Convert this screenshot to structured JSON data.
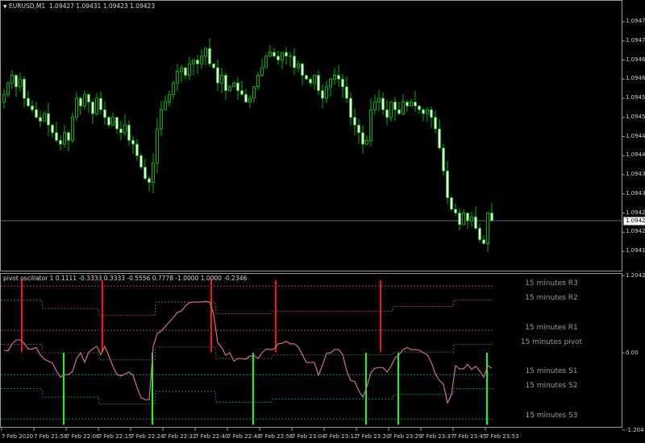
{
  "main_header": {
    "arrow_icon": "triangle-down-icon",
    "symbol": "EURUSD,M1",
    "ohlc": "1.09427 1.09431 1.09423 1.09423"
  },
  "osc_header": {
    "text": "pivot oscillator 1 0.1111 -0.3333 0.3333 -0.5556 0.7778 -1.0000 1.0000 -0.2346"
  },
  "price_axis": {
    "ticks": [
      "1.09475",
      "1.09470",
      "1.09465",
      "1.09460",
      "1.09455",
      "1.09450",
      "1.09445",
      "1.09440",
      "1.09435",
      "1.09430",
      "1.09425",
      "1.09420",
      "1.09415"
    ],
    "current": "1.09423"
  },
  "osc_axis": {
    "ticks": [
      "1.2042",
      "0.00",
      "-1.204"
    ]
  },
  "time_axis": {
    "labels": [
      "7 Feb 2020",
      "7 Feb 21:58",
      "7 Feb 22:06",
      "7 Feb 22:15",
      "7 Feb 22:24",
      "7 Feb 22:32",
      "7 Feb 22:40",
      "7 Feb 22:48",
      "7 Feb 22:56",
      "7 Feb 23:04",
      "7 Feb 23:12",
      "7 Feb 23:20",
      "7 Feb 23:29",
      "7 Feb 23:37",
      "7 Feb 23:45",
      "7 Feb 23:53"
    ]
  },
  "level_labels": {
    "r3": "15 minutes R3",
    "r2": "15 minutes R2",
    "r1": "15 minutes R1",
    "pivot": "15 minutes pivot",
    "s1": "15 minutes S1",
    "s2": "15 minutes S2",
    "s3": "15 minutes S3"
  },
  "colors": {
    "background": "#000000",
    "candle_wick": "#00b400",
    "bear_body": "#e8ffe8",
    "bull_outline": "#00c800",
    "current_price_line": "#5a6478",
    "osc_line": "#d0708a",
    "signal_up": "#ff1010",
    "signal_down": "#10ff10",
    "resistance_level": "#9c4a68",
    "pivot_level": "#5a5a5a",
    "support_level": "#1a7f9c"
  },
  "price_data": {
    "closes": [
      1.09456,
      1.09459,
      1.09461,
      1.09458,
      1.0946,
      1.09455,
      1.09453,
      1.09452,
      1.0945,
      1.09449,
      1.09451,
      1.09448,
      1.09446,
      1.09444,
      1.09443,
      1.09446,
      1.09444,
      1.0945,
      1.09455,
      1.09453,
      1.09456,
      1.09454,
      1.09451,
      1.09455,
      1.09452,
      1.0945,
      1.09448,
      1.0945,
      1.09447,
      1.09446,
      1.09448,
      1.09444,
      1.09443,
      1.0944,
      1.09437,
      1.09434,
      1.09433,
      1.09438,
      1.09447,
      1.09452,
      1.09454,
      1.09456,
      1.09459,
      1.09462,
      1.09463,
      1.09461,
      1.09464,
      1.09465,
      1.09464,
      1.09466,
      1.09468,
      1.09464,
      1.09463,
      1.09459,
      1.09461,
      1.09457,
      1.09458,
      1.09459,
      1.09457,
      1.09456,
      1.09454,
      1.09455,
      1.09458,
      1.09461,
      1.09463,
      1.09466,
      1.09467,
      1.09466,
      1.09465,
      1.09467,
      1.09466,
      1.09466,
      1.09463,
      1.09464,
      1.09461,
      1.0946,
      1.09459,
      1.09461,
      1.09457,
      1.09455,
      1.09458,
      1.0946,
      1.09461,
      1.0946,
      1.09458,
      1.09455,
      1.0945,
      1.09448,
      1.09446,
      1.09443,
      1.09444,
      1.09452,
      1.09454,
      1.09455,
      1.09452,
      1.0945,
      1.09454,
      1.09452,
      1.09451,
      1.09454,
      1.09453,
      1.09454,
      1.09453,
      1.09452,
      1.09451,
      1.09452,
      1.0945,
      1.09447,
      1.09442,
      1.09436,
      1.09429,
      1.09426,
      1.09425,
      1.09422,
      1.09425,
      1.09423,
      1.09424,
      1.09421,
      1.09418,
      1.09417,
      1.09425,
      1.09423
    ],
    "range": [
      1.09412,
      1.0948
    ]
  },
  "oscillator": {
    "range": [
      -1.204,
      1.2042
    ],
    "values": [
      0.04,
      0.03,
      0.14,
      0.2,
      0.2,
      0.15,
      0.06,
      0.06,
      0.08,
      -0.03,
      -0.1,
      -0.13,
      -0.16,
      -0.28,
      -0.38,
      -0.34,
      -0.34,
      -0.29,
      -0.09,
      0.0,
      -0.15,
      0.01,
      0.06,
      0.1,
      -0.03,
      0.1,
      -0.05,
      -0.21,
      -0.34,
      -0.36,
      -0.33,
      -0.3,
      -0.35,
      -0.54,
      -0.7,
      -0.73,
      -0.73,
      0.1,
      0.3,
      0.34,
      0.41,
      0.48,
      0.55,
      0.63,
      0.65,
      0.73,
      0.78,
      0.79,
      0.79,
      0.79,
      0.8,
      0.79,
      0.6,
      0.16,
      0.08,
      -0.04,
      0.0,
      -0.13,
      -0.09,
      -0.09,
      -0.1,
      -0.05,
      -0.04,
      -0.09,
      0.0,
      0.06,
      0.05,
      0.06,
      0.14,
      0.15,
      0.18,
      0.14,
      0.14,
      0.09,
      -0.03,
      -0.15,
      -0.15,
      -0.15,
      -0.35,
      -0.19,
      -0.01,
      0.0,
      0.05,
      0.05,
      -0.03,
      -0.28,
      -0.43,
      -0.45,
      -0.59,
      -0.69,
      -0.53,
      -0.31,
      -0.24,
      -0.23,
      -0.23,
      -0.3,
      -0.21,
      -0.08,
      -0.03,
      0.05,
      0.08,
      0.05,
      0.05,
      0.04,
      0.0,
      -0.03,
      -0.15,
      -0.33,
      -0.43,
      -0.49,
      -0.78,
      -0.65,
      -0.2,
      -0.25,
      -0.25,
      -0.18,
      -0.26,
      -0.21,
      -0.28,
      -0.38,
      -0.2,
      -0.24
    ],
    "signals_up": [
      4,
      24,
      51,
      67,
      93
    ],
    "signals_down": [
      15,
      37,
      62,
      90,
      98,
      120
    ],
    "signal_up_range": [
      0.01,
      1.13
    ],
    "signal_down_range": [
      -1.12,
      0.0
    ],
    "levels": {
      "r3": [
        {
          "from": 0,
          "to": 121,
          "value": 1.04
        }
      ],
      "r2": [
        {
          "from": 0,
          "to": 9,
          "value": 0.82
        },
        {
          "from": 10,
          "to": 23,
          "value": 0.69
        },
        {
          "from": 24,
          "to": 37,
          "value": 0.58
        },
        {
          "from": 38,
          "to": 52,
          "value": 0.79
        },
        {
          "from": 53,
          "to": 66,
          "value": 0.61
        },
        {
          "from": 67,
          "to": 96,
          "value": 0.65
        },
        {
          "from": 97,
          "to": 111,
          "value": 0.72
        },
        {
          "from": 112,
          "to": 121,
          "value": 0.82
        }
      ],
      "r1": [
        {
          "from": 0,
          "to": 121,
          "value": 0.35
        }
      ],
      "pivot": [
        {
          "from": 0,
          "to": 9,
          "value": 0.13
        },
        {
          "from": 10,
          "to": 23,
          "value": 0.0
        },
        {
          "from": 24,
          "to": 37,
          "value": -0.11
        },
        {
          "from": 38,
          "to": 52,
          "value": 0.09
        },
        {
          "from": 53,
          "to": 66,
          "value": -0.09
        },
        {
          "from": 67,
          "to": 96,
          "value": -0.03
        },
        {
          "from": 97,
          "to": 111,
          "value": 0.01
        },
        {
          "from": 112,
          "to": 121,
          "value": 0.13
        }
      ],
      "s1": [
        {
          "from": 0,
          "to": 121,
          "value": -0.34
        }
      ],
      "s2": [
        {
          "from": 0,
          "to": 9,
          "value": -0.56
        },
        {
          "from": 10,
          "to": 23,
          "value": -0.69
        },
        {
          "from": 24,
          "to": 37,
          "value": -0.8
        },
        {
          "from": 38,
          "to": 52,
          "value": -0.6
        },
        {
          "from": 53,
          "to": 66,
          "value": -0.77
        },
        {
          "from": 67,
          "to": 96,
          "value": -0.72
        },
        {
          "from": 97,
          "to": 111,
          "value": -0.65
        },
        {
          "from": 112,
          "to": 121,
          "value": -0.56
        }
      ],
      "s3": [
        {
          "from": 0,
          "to": 121,
          "value": -1.03
        }
      ]
    }
  }
}
